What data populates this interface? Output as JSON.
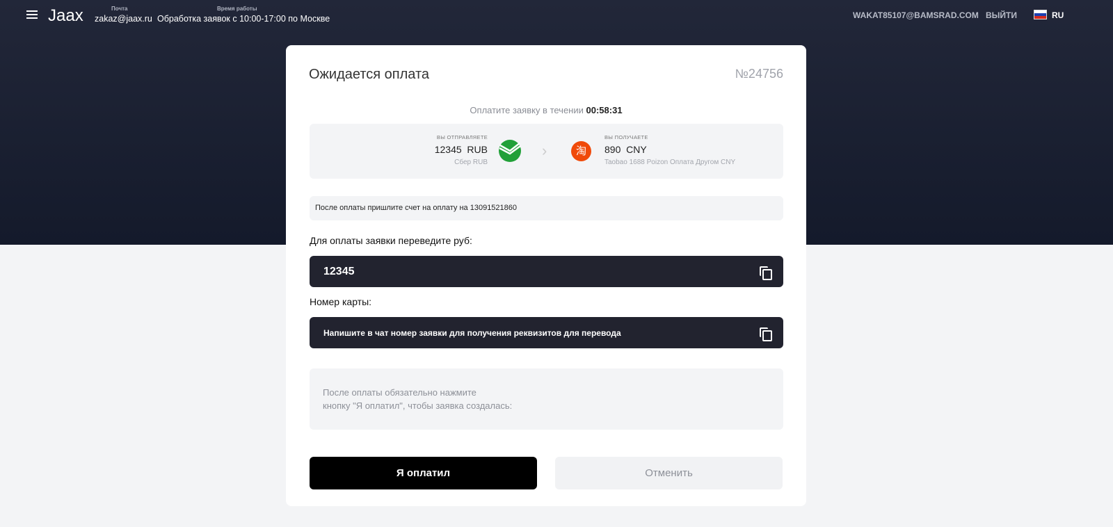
{
  "header": {
    "logo": "Jaax",
    "mail_label": "Почта",
    "mail": "zakaz@jaax.ru",
    "hours_label": "Время работы",
    "hours": "Обработка заявок с 10:00-17:00 по Москве",
    "user_email": "WAKAT85107@BAMSRAD.COM",
    "logout": "ВЫЙТИ",
    "lang": "RU"
  },
  "card": {
    "title": "Ожидается оплата",
    "order_number": "№24756",
    "timer_text": "Оплатите заявку в течении",
    "timer": "00:58:31",
    "send": {
      "label": "ВЫ ОТПРАВЛЯЕТЕ",
      "amount": "12345  RUB",
      "method": "Сбер RUB",
      "icon": "sberbank-icon",
      "color": "#21a038"
    },
    "receive": {
      "label": "ВЫ ПОЛУЧАЕТЕ",
      "amount": "890  CNY",
      "method": "Taobao 1688 Poizon Оплата Другом CNY",
      "icon": "taobao-icon",
      "icon_text": "淘",
      "color": "#f04a0a"
    },
    "note": "После оплаты пришлите счет на оплату на 13091521860",
    "amount_label": "Для оплаты заявки переведите руб:",
    "amount_value": "12345",
    "card_label": "Номер карты:",
    "card_value": "Напишите в чат номер заявки для получения реквизитов для перевода",
    "info_line1": "После оплаты обязательно нажмите",
    "info_line2": "кнопку \"Я оплатил\", чтобы заявка создалась:",
    "paid_button": "Я оплатил",
    "cancel_button": "Отменить"
  }
}
